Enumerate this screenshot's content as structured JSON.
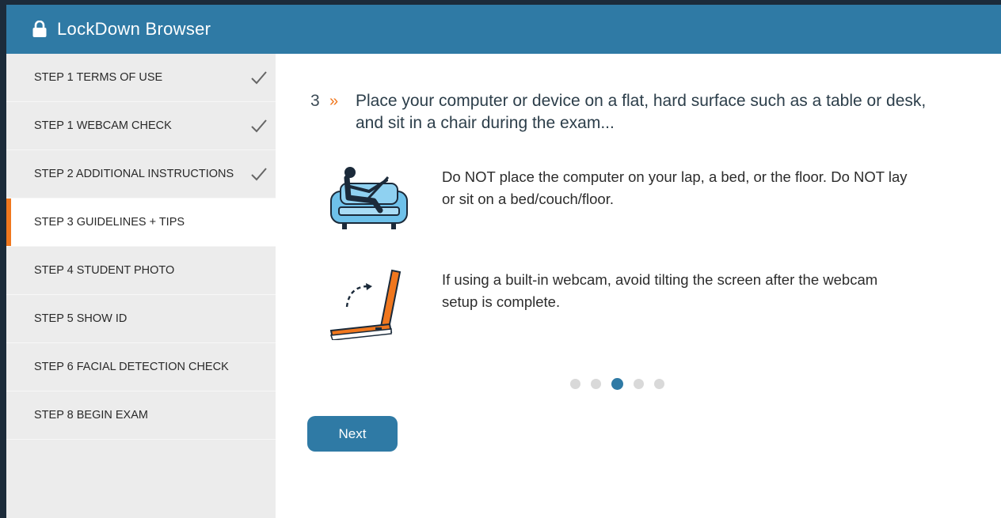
{
  "window": {
    "title": "LockDown Browser",
    "lock_icon": "lock-icon"
  },
  "colors": {
    "header": "#2f7aa5",
    "accent": "#f0771e",
    "sidebar": "#ececec",
    "button": "#2f7aa5"
  },
  "sidebar": {
    "items": [
      {
        "label": "STEP 1 TERMS OF USE",
        "completed": true,
        "active": false
      },
      {
        "label": "STEP 1 WEBCAM CHECK",
        "completed": true,
        "active": false
      },
      {
        "label": "STEP 2 ADDITIONAL INSTRUCTIONS",
        "completed": true,
        "active": false
      },
      {
        "label": "STEP 3 GUIDELINES + TIPS",
        "completed": false,
        "active": true
      },
      {
        "label": "STEP 4 STUDENT PHOTO",
        "completed": false,
        "active": false
      },
      {
        "label": "STEP 5 SHOW ID",
        "completed": false,
        "active": false
      },
      {
        "label": "STEP 6 FACIAL DETECTION CHECK",
        "completed": false,
        "active": false
      },
      {
        "label": "STEP 8 BEGIN EXAM",
        "completed": false,
        "active": false
      }
    ]
  },
  "main": {
    "instruction": {
      "number": "3",
      "chevron": "»",
      "text": "Place your computer or device on a flat, hard surface such as a table or desk, and sit in a chair during the exam..."
    },
    "tips": [
      {
        "icon": "person-on-couch-icon",
        "text": "Do NOT place the computer on your lap, a bed, or the floor. Do NOT lay or sit on a bed/couch/floor."
      },
      {
        "icon": "laptop-tilt-icon",
        "text": "If using a built-in webcam, avoid tilting the screen after the webcam setup is complete."
      }
    ],
    "pagination": {
      "total": 5,
      "current": 3
    },
    "next_label": "Next"
  }
}
